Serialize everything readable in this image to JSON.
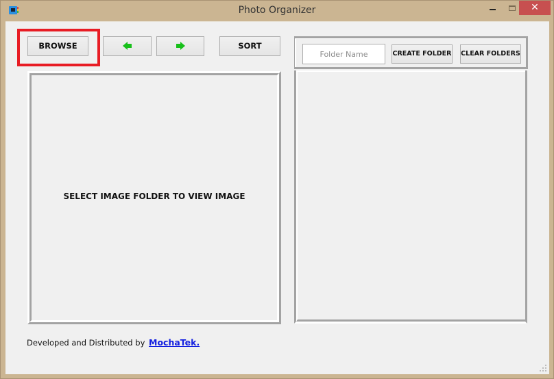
{
  "window": {
    "title": "Photo Organizer",
    "controls": {
      "minimize": "minimize",
      "maximize": "maximize",
      "close": "✕"
    }
  },
  "toolbar": {
    "browse_label": "BROWSE",
    "prev_icon": "arrow-left-icon",
    "next_icon": "arrow-right-icon",
    "sort_label": "SORT"
  },
  "image_viewer": {
    "placeholder_text": "SELECT IMAGE FOLDER TO VIEW IMAGE"
  },
  "folders": {
    "input_value": "",
    "input_placeholder": "Folder Name",
    "create_label": "CREATE FOLDER",
    "clear_label": "CLEAR FOLDERS",
    "items": []
  },
  "footer": {
    "text": "Developed and Distributed by",
    "link_text": "MochaTek."
  },
  "colors": {
    "highlight": "#e81c24",
    "arrow": "#17c01a",
    "link": "#1420e0",
    "close_button": "#c75050",
    "frame": "#cbb592"
  }
}
